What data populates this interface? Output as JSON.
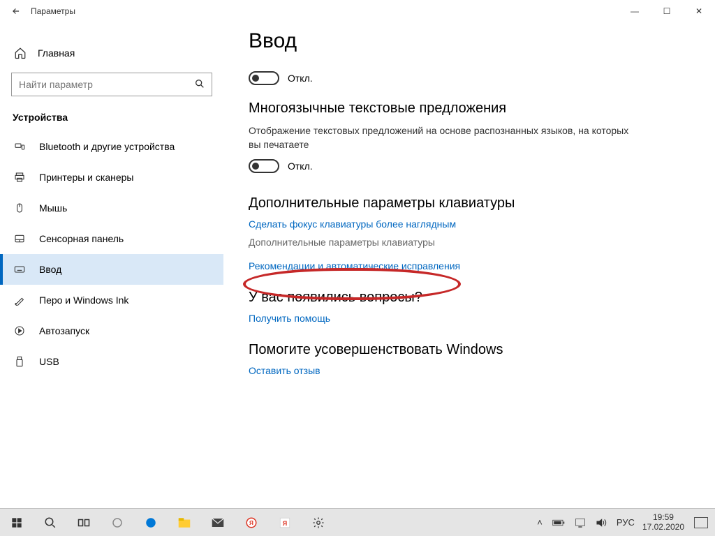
{
  "window": {
    "title": "Параметры",
    "controls": {
      "minimize": "—",
      "maximize": "☐",
      "close": "✕"
    }
  },
  "sidebar": {
    "home": "Главная",
    "search_placeholder": "Найти параметр",
    "section": "Устройства",
    "items": [
      {
        "icon": "bluetooth",
        "label": "Bluetooth и другие устройства",
        "active": false
      },
      {
        "icon": "printer",
        "label": "Принтеры и сканеры",
        "active": false
      },
      {
        "icon": "mouse",
        "label": "Мышь",
        "active": false
      },
      {
        "icon": "touchpad",
        "label": "Сенсорная панель",
        "active": false
      },
      {
        "icon": "keyboard",
        "label": "Ввод",
        "active": true
      },
      {
        "icon": "pen",
        "label": "Перо и Windows Ink",
        "active": false
      },
      {
        "icon": "autoplay",
        "label": "Автозапуск",
        "active": false
      },
      {
        "icon": "usb",
        "label": "USB",
        "active": false
      }
    ]
  },
  "content": {
    "page_title": "Ввод",
    "toggle1_state": "Откл.",
    "section_multilang": "Многоязычные текстовые предложения",
    "multilang_desc": "Отображение текстовых предложений на основе распознанных языков, на которых вы печатаете",
    "toggle2_state": "Откл.",
    "section_extra": "Дополнительные параметры клавиатуры",
    "link_focus": "Сделать фокус клавиатуры более наглядным",
    "link_extra": "Дополнительные параметры клавиатуры",
    "link_recommend": "Рекомендации и автоматические исправления",
    "section_questions": "У вас появились вопросы?",
    "link_help": "Получить помощь",
    "section_feedback": "Помогите усовершенствовать Windows",
    "link_feedback": "Оставить отзыв"
  },
  "taskbar": {
    "lang": "РУС",
    "time": "19:59",
    "date": "17.02.2020"
  }
}
